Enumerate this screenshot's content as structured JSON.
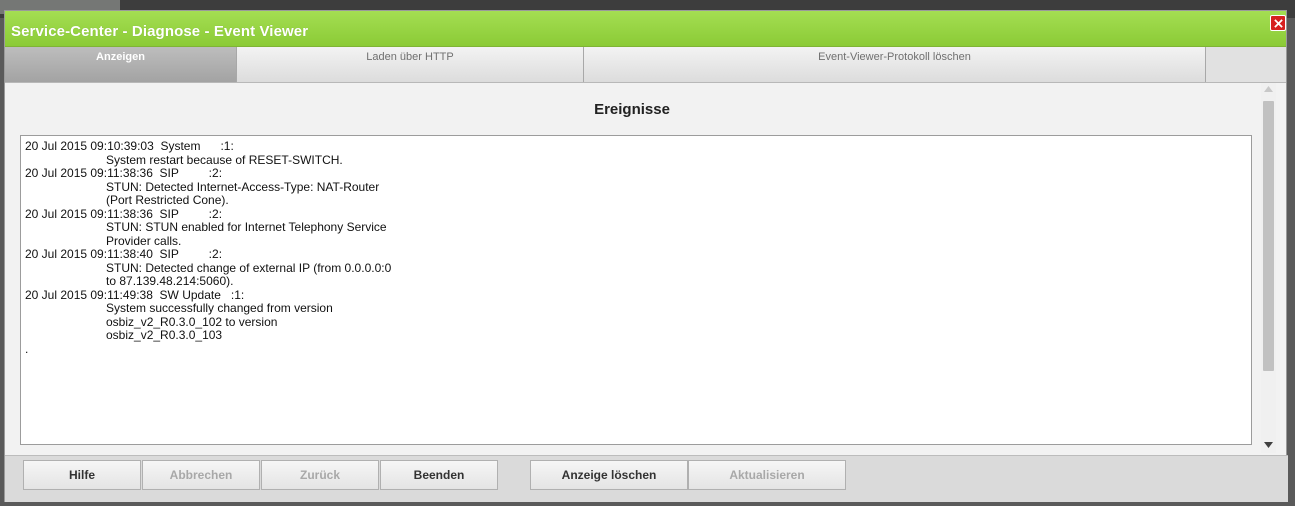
{
  "window": {
    "title": "Service-Center - Diagnose - Event Viewer",
    "close_icon": "close-icon"
  },
  "tabs": [
    {
      "label": "Anzeigen",
      "active": true
    },
    {
      "label": "Laden über HTTP",
      "active": false
    },
    {
      "label": "Event-Viewer-Protokoll löschen",
      "active": false
    }
  ],
  "main": {
    "heading": "Ereignisse",
    "entries": [
      {
        "header": "20 Jul 2015 09:10:39:03  System      :1:",
        "message": "System restart because of RESET-SWITCH."
      },
      {
        "header": "20 Jul 2015 09:11:38:36  SIP         :2:",
        "message": "STUN: Detected Internet-Access-Type: NAT-Router (Port Restricted Cone)."
      },
      {
        "header": "20 Jul 2015 09:11:38:36  SIP         :2:",
        "message": "STUN: STUN enabled for Internet Telephony Service Provider calls."
      },
      {
        "header": "20 Jul 2015 09:11:38:40  SIP         :2:",
        "message": "STUN: Detected change of external IP (from 0.0.0.0:0 to 87.139.48.214:5060)."
      },
      {
        "header": "20 Jul 2015 09:11:49:38  SW Update   :1:",
        "message": "System successfully changed from version osbiz_v2_R0.3.0_102 to version osbiz_v2_R0.3.0_103"
      }
    ],
    "trailing": "."
  },
  "footer": {
    "buttons": [
      {
        "label": "Hilfe",
        "enabled": true
      },
      {
        "label": "Abbrechen",
        "enabled": false
      },
      {
        "label": "Zurück",
        "enabled": false
      },
      {
        "label": "Beenden",
        "enabled": true
      },
      {
        "label": "Anzeige löschen",
        "enabled": true
      },
      {
        "label": "Aktualisieren",
        "enabled": false
      }
    ]
  },
  "colors": {
    "titlebar": "#95d443",
    "active_tab": "#b0b0b0",
    "close": "#d62020"
  }
}
